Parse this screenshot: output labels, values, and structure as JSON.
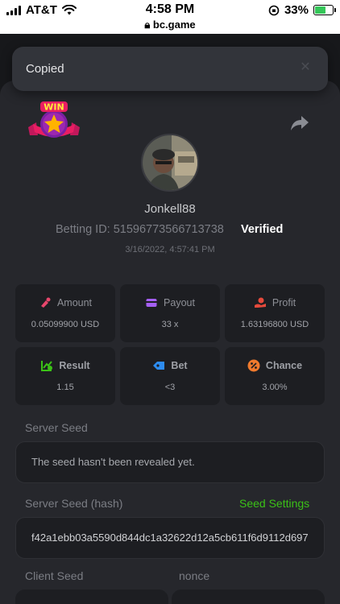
{
  "status_bar": {
    "carrier": "AT&T",
    "time": "4:58 PM",
    "battery": "33%",
    "url": "bc.game"
  },
  "toast": {
    "text": "Copied"
  },
  "bet": {
    "username": "Jonkell88",
    "betting_id": "Betting ID: 515967735667137​38",
    "verified": "Verified",
    "datetime": "3/16/2022, 4:57:41 PM"
  },
  "stats": [
    {
      "label": "Amount",
      "value": "0.05099900 USD",
      "icon": "coins-icon",
      "color": "#e8466c"
    },
    {
      "label": "Payout",
      "value": "33 x",
      "icon": "wallet-icon",
      "color": "#a55ff2"
    },
    {
      "label": "Profit",
      "value": "1.63196800 USD",
      "icon": "profit-icon",
      "color": "#e64a3c"
    },
    {
      "label": "Result",
      "value": "1.15",
      "icon": "chart-check-icon",
      "color": "#3bc117"
    },
    {
      "label": "Bet",
      "value": "<3",
      "icon": "tag-icon",
      "color": "#2d8cf0"
    },
    {
      "label": "Chance",
      "value": "3.00%",
      "icon": "percent-icon",
      "color": "#f07a2d"
    }
  ],
  "seeds": {
    "server_seed_label": "Server Seed",
    "server_seed_value": "The seed hasn't been revealed yet.",
    "server_hash_label": "Server Seed (hash)",
    "seed_settings_label": "Seed Settings",
    "server_hash_value": "f42a1ebb03a5590d844dc1a32622d12a5cb611f6d9112d697",
    "client_seed_label": "Client Seed",
    "nonce_label": "nonce"
  },
  "colors": {
    "accent_green": "#3bc117",
    "panel": "#26272c",
    "field": "#1d1e22"
  }
}
